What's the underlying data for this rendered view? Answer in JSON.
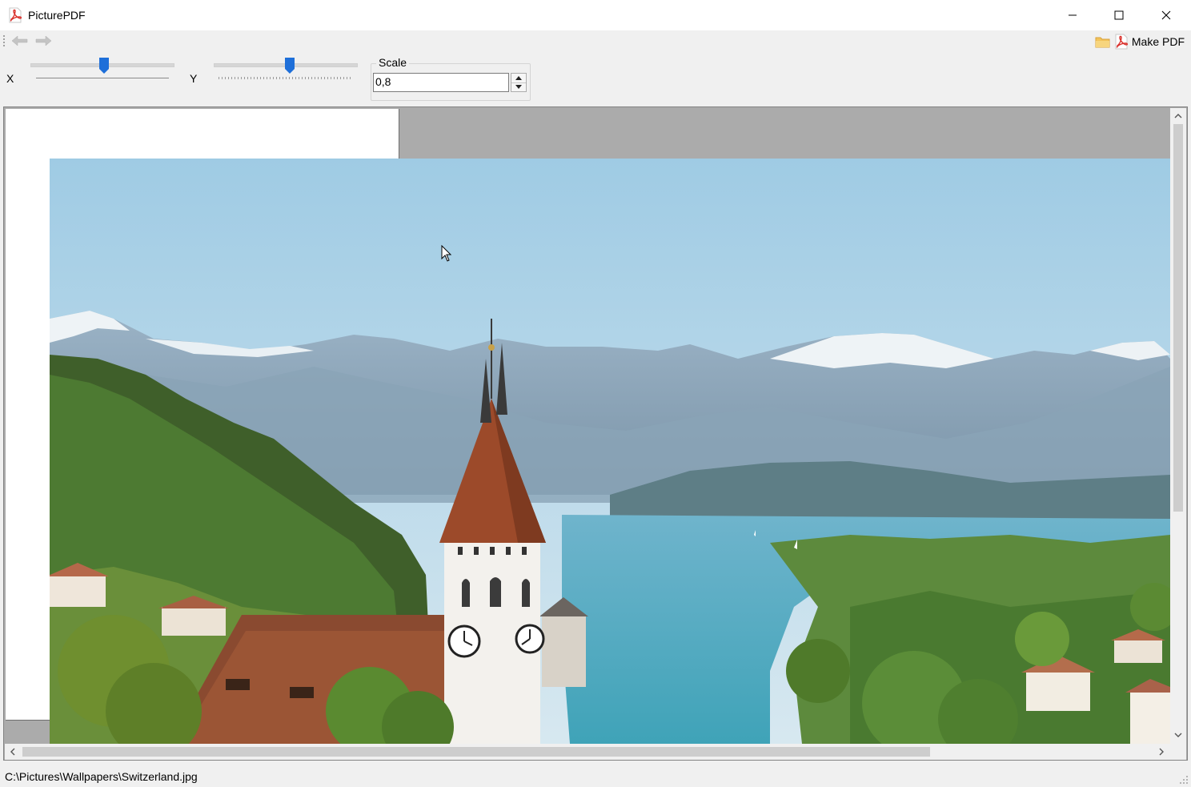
{
  "window": {
    "title": "PicturePDF",
    "minimize_label": "Minimize",
    "maximize_label": "Maximize",
    "close_label": "Close"
  },
  "toolbar": {
    "back_icon": "arrow-left-icon",
    "forward_icon": "arrow-right-icon",
    "open_folder_icon": "folder-icon",
    "make_pdf_icon": "pdf-icon",
    "make_pdf_label": "Make PDF"
  },
  "position": {
    "x_label": "X",
    "y_label": "Y",
    "x_slider_value": 0.5,
    "y_slider_value": 0.5
  },
  "scale": {
    "legend": "Scale",
    "value": "0,8"
  },
  "canvas": {
    "page_color": "#ffffff",
    "background_color": "#ababab",
    "image_subject": "landscape photo of Thun, Switzerland: church tower, lake and Alps"
  },
  "status": {
    "file_path": "C:\\Pictures\\Wallpapers\\Switzerland.jpg"
  },
  "colors": {
    "accent": "#1e6fd9",
    "pdf_red": "#d9302b"
  }
}
